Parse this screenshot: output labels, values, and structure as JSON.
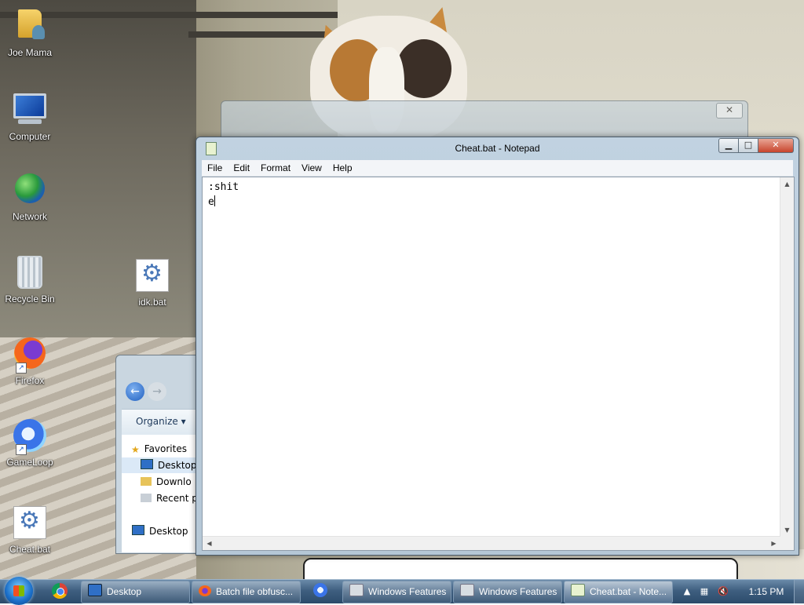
{
  "desktop": {
    "icons": [
      {
        "label": "Joe Mama",
        "icon": "user-folder-icon"
      },
      {
        "label": "Computer",
        "icon": "computer-icon"
      },
      {
        "label": "Network",
        "icon": "network-globe-icon"
      },
      {
        "label": "Recycle Bin",
        "icon": "recycle-bin-icon"
      },
      {
        "label": "idk.bat",
        "icon": "batch-file-icon"
      },
      {
        "label": "Firefox",
        "icon": "firefox-icon"
      },
      {
        "label": "GameLoop",
        "icon": "gameloop-icon"
      },
      {
        "label": "Cheat.bat",
        "icon": "batch-file-icon"
      }
    ]
  },
  "explorer": {
    "organize_label": "Organize ▾",
    "tree": [
      {
        "label": "Favorites"
      },
      {
        "label": "Desktop"
      },
      {
        "label": "Downlo"
      },
      {
        "label": "Recent p"
      },
      {
        "label": "Desktop"
      }
    ]
  },
  "notepad": {
    "title": "Cheat.bat - Notepad",
    "menu": [
      "File",
      "Edit",
      "Format",
      "View",
      "Help"
    ],
    "content": ":shit\ne",
    "controls": {
      "minimize": "▁",
      "maximize": "□",
      "close": "✕"
    }
  },
  "taskbar": {
    "buttons": [
      {
        "label": "Desktop",
        "icon": "desktop-icon",
        "active": false
      },
      {
        "label": "Batch file obfusc...",
        "icon": "firefox-icon",
        "active": false
      },
      {
        "label": "Windows Features",
        "icon": "windows-features-icon",
        "active": false
      },
      {
        "label": "Windows Features",
        "icon": "windows-features-icon",
        "active": false
      },
      {
        "label": "Cheat.bat - Note...",
        "icon": "notepad-icon",
        "active": true
      }
    ],
    "clock": "1:15 PM"
  },
  "colors": {
    "taskbar": "#3f5f80",
    "window_frame": "#b9cbdb",
    "close_button": "#c7442c"
  }
}
